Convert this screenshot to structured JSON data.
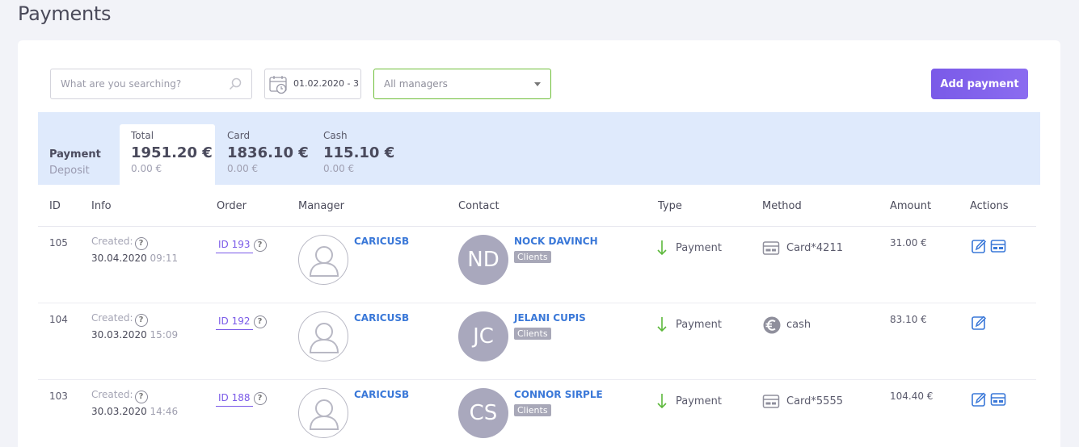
{
  "page": {
    "title": "Payments"
  },
  "filters": {
    "search_placeholder": "What are you searching?",
    "date_value": "01.02.2020 - 3",
    "managers_value": "All managers",
    "add_button_label": "Add payment"
  },
  "summary": {
    "label": "Payment",
    "sublabel": "Deposit",
    "tabs": [
      {
        "label": "Total",
        "value": "1951.20 €",
        "sub": "0.00 €"
      },
      {
        "label": "Card",
        "value": "1836.10 €",
        "sub": "0.00 €"
      },
      {
        "label": "Cash",
        "value": "115.10 €",
        "sub": "0.00 €"
      }
    ]
  },
  "table": {
    "headers": [
      "ID",
      "Info",
      "Order",
      "Manager",
      "Contact",
      "Type",
      "Method",
      "Amount",
      "Actions"
    ],
    "rows": [
      {
        "id": "105",
        "created_label": "Created:",
        "date": "30.04.2020",
        "time": "09:11",
        "order": "ID 193",
        "manager": "CARICUSB",
        "contact_initials": "ND",
        "contact_name": "NOCK DAVINCH",
        "contact_badge": "Clients",
        "type": "Payment",
        "method_icon": "card-icon",
        "method": "Card*4211",
        "amount": "31.00 €",
        "actions": [
          "edit-icon",
          "card-icon"
        ]
      },
      {
        "id": "104",
        "created_label": "Created:",
        "date": "30.03.2020",
        "time": "15:09",
        "order": "ID 192",
        "manager": "CARICUSB",
        "contact_initials": "JC",
        "contact_name": "JELANI CUPIS",
        "contact_badge": "Clients",
        "type": "Payment",
        "method_icon": "euro-icon",
        "method": "cash",
        "amount": "83.10 €",
        "actions": [
          "edit-icon"
        ]
      },
      {
        "id": "103",
        "created_label": "Created:",
        "date": "30.03.2020",
        "time": "14:46",
        "order": "ID 188",
        "manager": "CARICUSB",
        "contact_initials": "CS",
        "contact_name": "CONNOR SIRPLE",
        "contact_badge": "Clients",
        "type": "Payment",
        "method_icon": "card-icon",
        "method": "Card*5555",
        "amount": "104.40 €",
        "actions": [
          "edit-icon",
          "card-icon"
        ]
      }
    ]
  },
  "colors": {
    "accent": "#7a5ae8",
    "link": "#3a78d8",
    "summary_bg": "#dfeafc",
    "success": "#6fbf3a"
  }
}
